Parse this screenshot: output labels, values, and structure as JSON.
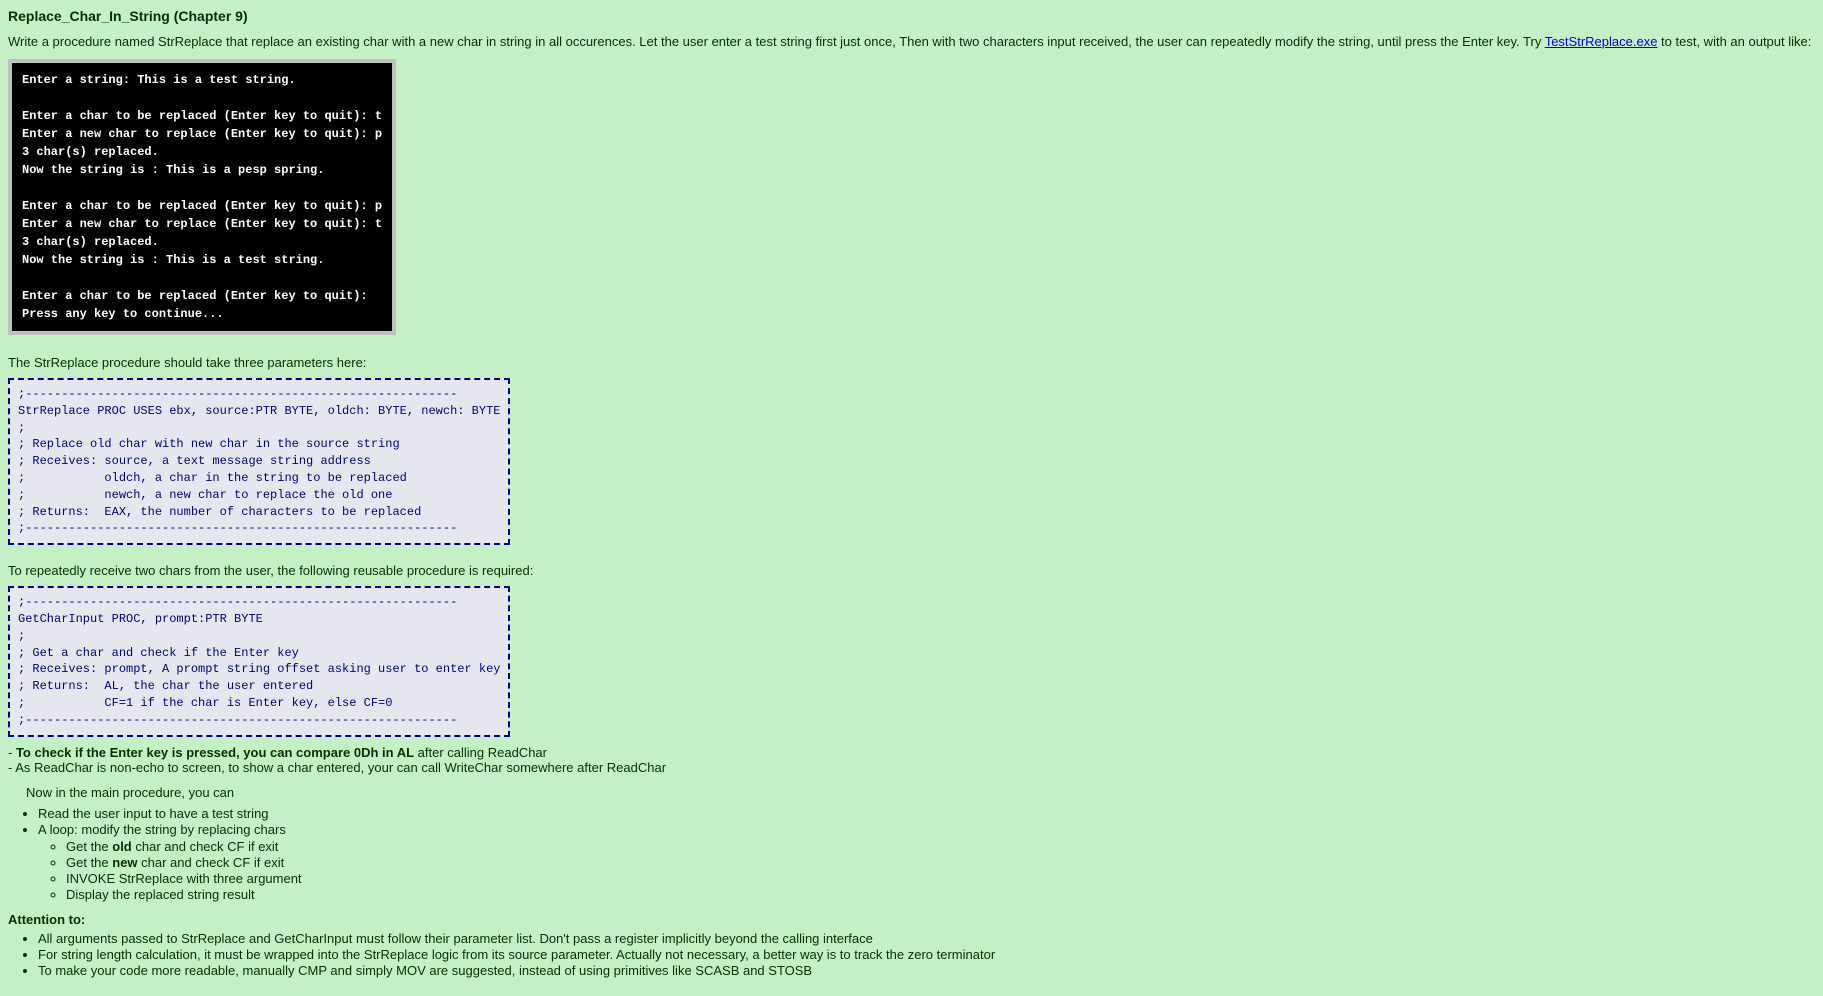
{
  "title": "Replace_Char_In_String (Chapter 9)",
  "intro_before_link": "Write a procedure named StrReplace that replace an existing char with a new char in string in all occurences. Let the user enter a test string first just once, Then with two characters input received, the user can repeatedly modify the string, until press the Enter key. Try ",
  "link_text": "TestStrReplace.exe",
  "intro_after_link": " to test, with an output like:",
  "console": "Enter a string: This is a test string.\n\nEnter a char to be replaced (Enter key to quit): t\nEnter a new char to replace (Enter key to quit): p\n3 char(s) replaced.\nNow the string is : This is a pesp spring.\n\nEnter a char to be replaced (Enter key to quit): p\nEnter a new char to replace (Enter key to quit): t\n3 char(s) replaced.\nNow the string is : This is a test string.\n\nEnter a char to be replaced (Enter key to quit):\nPress any key to continue...",
  "para1": "The StrReplace procedure should take three parameters here:",
  "code1": ";------------------------------------------------------------\nStrReplace PROC USES ebx, source:PTR BYTE, oldch: BYTE, newch: BYTE\n;\n; Replace old char with new char in the source string\n; Receives: source, a text message string address\n;           oldch, a char in the string to be replaced\n;           newch, a new char to replace the old one\n; Returns:  EAX, the number of characters to be replaced\n;------------------------------------------------------------",
  "para2": "To repeatedly receive two chars from the user, the following reusable procedure is required:",
  "code2": ";------------------------------------------------------------\nGetCharInput PROC, prompt:PTR BYTE\n;\n; Get a char and check if the Enter key\n; Receives: prompt, A prompt string offset asking user to enter key\n; Returns:  AL, the char the user entered\n;           CF=1 if the char is Enter key, else CF=0\n;------------------------------------------------------------",
  "note1_prefix": "- ",
  "note1_bold": "To check if the Enter key is pressed, you can compare 0Dh in AL",
  "note1_suffix": " after calling ReadChar",
  "note2": "- As ReadChar is non-echo to screen, to show a char entered, your can call WriteChar somewhere after ReadChar",
  "main_intro": "Now in the main procedure, you can",
  "main_list": {
    "item1": "Read the user input to have a test string",
    "item2": "A loop: modify the string by replacing chars",
    "sub1_before": "Get the ",
    "sub1_bold": "old",
    "sub1_after": " char and check CF if exit",
    "sub2_before": "Get the ",
    "sub2_bold": "new",
    "sub2_after": " char and check CF if exit",
    "sub3": "INVOKE StrReplace with three argument",
    "sub4": "Display the replaced string result"
  },
  "attention_title": "Attention to:",
  "attention": {
    "a1": "All arguments passed to StrReplace and GetCharInput must follow their parameter list. Don't pass a register implicitly beyond the calling interface",
    "a2": "For string length calculation, it must be wrapped into the StrReplace logic from its source parameter. Actually not necessary, a better way is to track the zero terminator",
    "a3": "To make your code more readable, manually CMP and simply MOV are suggested, instead of using primitives like SCASB and STOSB"
  }
}
